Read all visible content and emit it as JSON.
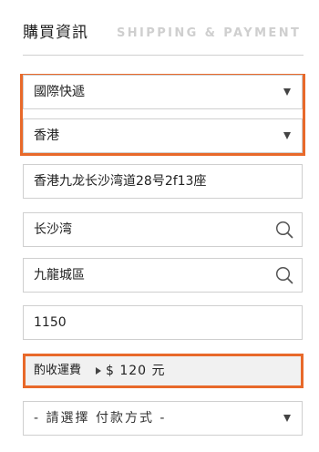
{
  "header": {
    "title": "購買資訊",
    "subtitle": "SHIPPING & PAYMENT"
  },
  "shipping_method": {
    "selected": "國際快遞",
    "icon": "chevron-down-icon"
  },
  "region": {
    "selected": "香港",
    "icon": "chevron-down-icon"
  },
  "address": {
    "value": "香港九龙长沙湾道28号2f13座"
  },
  "district": {
    "value": "长沙湾",
    "icon": "search-icon"
  },
  "area": {
    "value": "九龍城區",
    "icon": "search-icon"
  },
  "postal_code": {
    "value": "1150"
  },
  "shipping_fee": {
    "label": "酌收運費",
    "amount": "$ 120 元"
  },
  "payment_method": {
    "placeholder": "- 請選擇 付款方式 -",
    "icon": "chevron-down-icon"
  },
  "colors": {
    "highlight": "#e8692a",
    "border": "#cfcfcf",
    "fee_background": "#f1f1f1",
    "subtitle": "#cfcfcf"
  }
}
